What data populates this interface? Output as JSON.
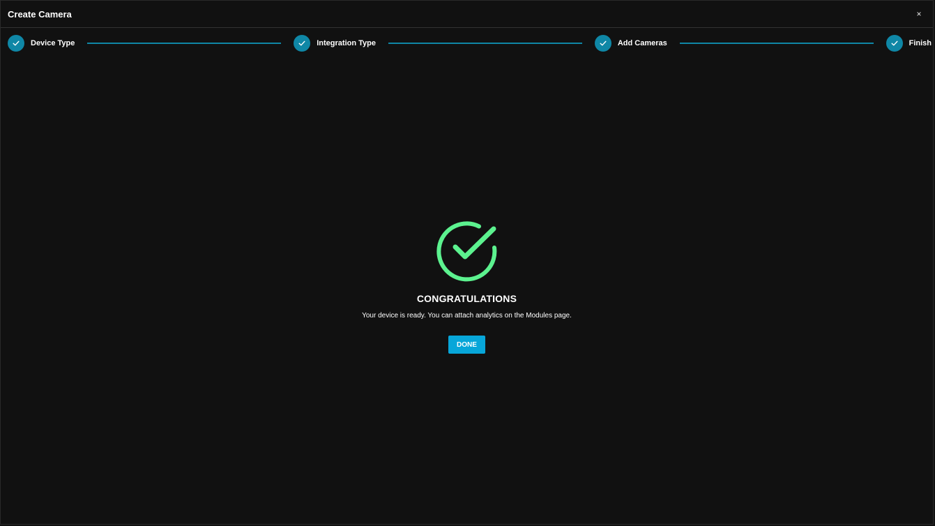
{
  "window": {
    "title": "Create Camera",
    "close_glyph": "×",
    "close_icon": "close-icon"
  },
  "stepper": {
    "color": "#0f87a6",
    "steps": [
      {
        "label": "Device Type",
        "status": "completed",
        "icon": "check-icon"
      },
      {
        "label": "Integration Type",
        "status": "completed",
        "icon": "check-icon"
      },
      {
        "label": "Add Cameras",
        "status": "completed",
        "icon": "check-icon"
      },
      {
        "label": "Finish",
        "status": "completed",
        "icon": "check-icon"
      }
    ]
  },
  "result": {
    "icon": "success-check-icon",
    "icon_color": "#5cf28f",
    "headline": "CONGRATULATIONS",
    "message": "Your device is ready. You can attach analytics on the Modules page.",
    "done_label": "DONE",
    "done_color": "#07a6d9"
  }
}
